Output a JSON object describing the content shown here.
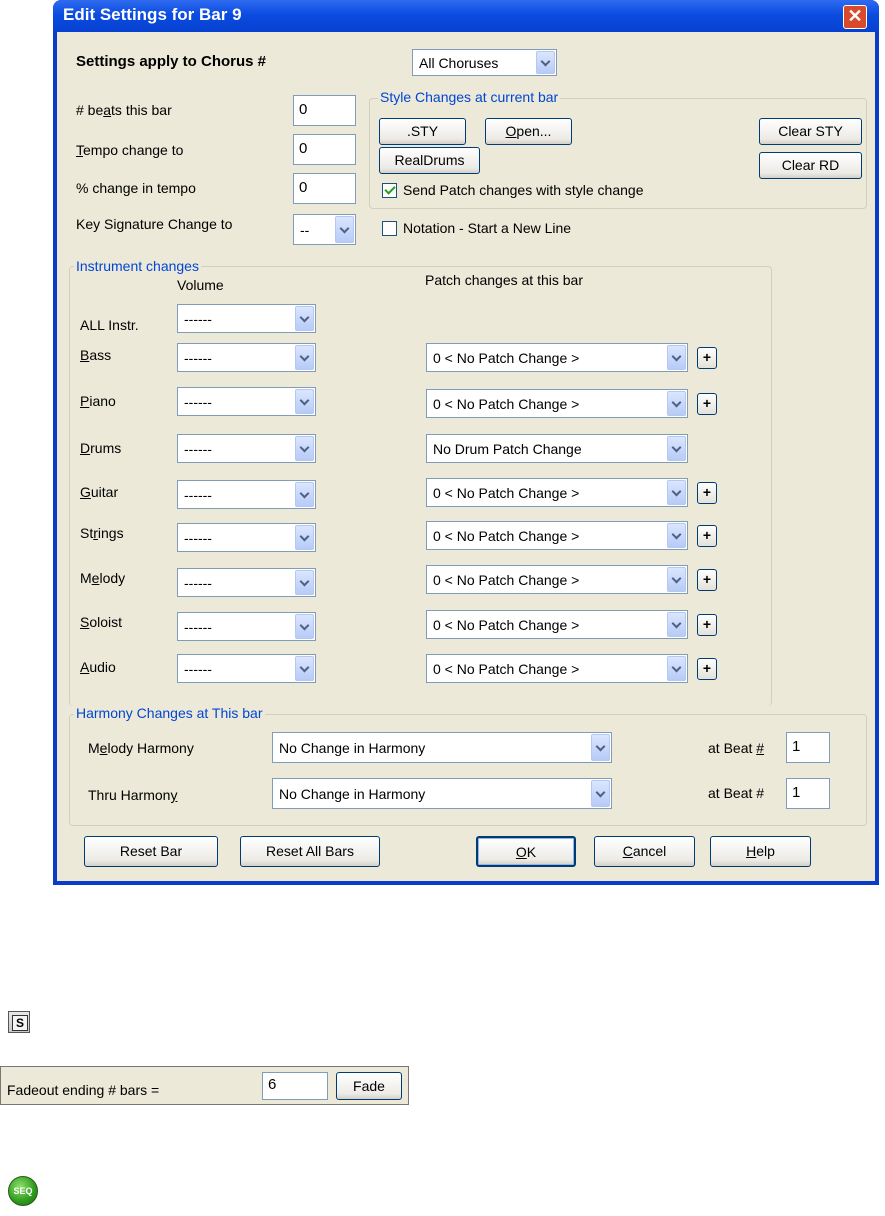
{
  "dialog": {
    "title": "Edit Settings for Bar 9",
    "chorus_label": "Settings apply to Chorus #",
    "chorus_value": "All Choruses",
    "beats_label": "# beats this bar",
    "beats_value": "0",
    "tempo_label": "Tempo change to",
    "tempo_value": "0",
    "pct_label": "% change in tempo",
    "pct_value": "0",
    "key_label": "Key Signature Change to",
    "key_value": "--"
  },
  "style_group": {
    "title": "Style Changes at current bar",
    "sty_btn": ".STY",
    "open_btn": "Open...",
    "realdrums_btn": "RealDrums",
    "clear_sty_btn": "Clear STY",
    "clear_rd_btn": "Clear RD",
    "send_patch_label": "Send Patch changes with style change",
    "send_patch_checked": true
  },
  "notation": {
    "label": "Notation - Start a New Line",
    "checked": false
  },
  "instruments": {
    "title": "Instrument changes",
    "volume_header": "Volume",
    "patch_header": "Patch changes at this bar",
    "rows": [
      {
        "name": "ALL Instr.",
        "volume": "------",
        "patch": ""
      },
      {
        "name": "Bass",
        "volume": "------",
        "patch": "0 < No Patch Change >"
      },
      {
        "name": "Piano",
        "volume": "------",
        "patch": "0 < No Patch Change >"
      },
      {
        "name": "Drums",
        "volume": "------",
        "patch": "No Drum Patch Change"
      },
      {
        "name": "Guitar",
        "volume": "------",
        "patch": "0 < No Patch Change >"
      },
      {
        "name": "Strings",
        "volume": "------",
        "patch": "0 < No Patch Change >"
      },
      {
        "name": "Melody",
        "volume": "------",
        "patch": "0 < No Patch Change >"
      },
      {
        "name": "Soloist",
        "volume": "------",
        "patch": "0 < No Patch Change >"
      },
      {
        "name": "Audio",
        "volume": "------",
        "patch": "0 < No Patch Change >"
      }
    ],
    "plus_label": "+"
  },
  "harmony": {
    "title": "Harmony Changes at This bar",
    "melody_label": "Melody Harmony",
    "melody_value": "No Change in Harmony",
    "thru_label": "Thru Harmony",
    "thru_value": "No Change in Harmony",
    "beat_label": "at Beat #",
    "melody_beat": "1",
    "thru_beat": "1"
  },
  "buttons": {
    "reset_bar": "Reset Bar",
    "reset_all": "Reset All Bars",
    "ok": "OK",
    "cancel": "Cancel",
    "help": "Help"
  },
  "s_icon_label": "S",
  "fadeout": {
    "label": "Fadeout ending # bars =",
    "value": "6",
    "button": "Fade"
  },
  "seq_icon_label": "SEQ",
  "colors": {
    "title_bar": "#0b4ce0",
    "group_title": "#0046d5",
    "dialog_bg": "#ece9d8"
  }
}
